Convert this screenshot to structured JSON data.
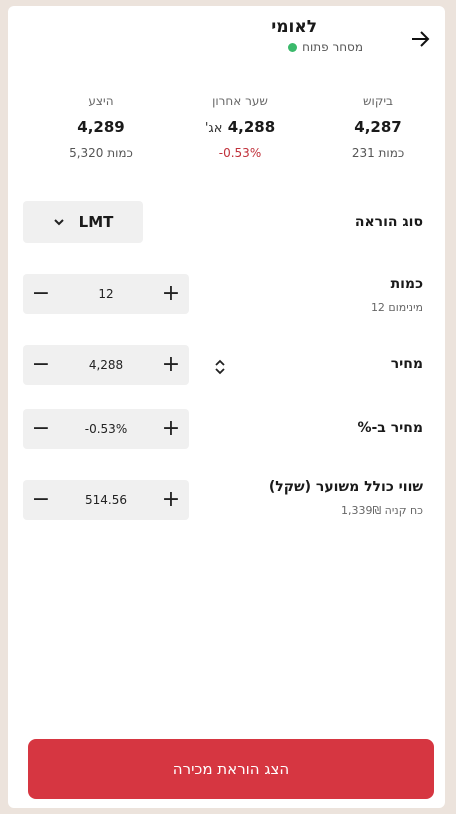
{
  "header": {
    "stock_name": "לאומי",
    "status_text": "מסחר פתוח",
    "status_color": "#3bb96b"
  },
  "quotes": {
    "bid": {
      "label": "ביקוש",
      "price": "4,287",
      "qty": "כמות 231"
    },
    "last": {
      "label": "שער אחרון",
      "price": "4,288",
      "unit": "אג'",
      "change": "-0.53%"
    },
    "ask": {
      "label": "היצע",
      "price": "4,289",
      "qty": "כמות 5,320"
    }
  },
  "order_type": {
    "label": "סוג הוראה",
    "value": "LMT"
  },
  "quantity": {
    "label": "כמות",
    "sub": "מינימום 12",
    "value": "12"
  },
  "price": {
    "label": "מחיר",
    "value": "4,288"
  },
  "price_pct": {
    "label": "מחיר ב-%",
    "value": "-0.53%"
  },
  "total": {
    "label": "שווי כולל משוער (שקל)",
    "sub": "כח קניה 1,339₪",
    "value": "514.56"
  },
  "submit": {
    "label": "הצג הוראת מכירה",
    "color": "#d63641"
  },
  "icons": {
    "back": "arrow-right-icon",
    "minus": "minus-icon",
    "plus": "plus-icon"
  }
}
